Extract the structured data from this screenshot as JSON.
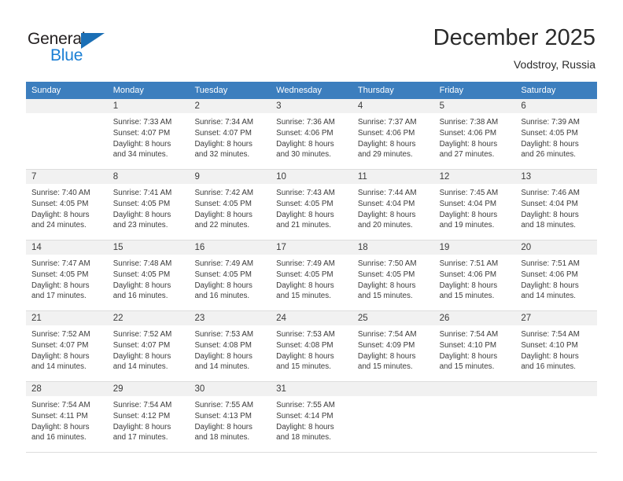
{
  "brand": {
    "name_top": "General",
    "name_bottom": "Blue",
    "triangle_color": "#1b6fb5",
    "blue_color": "#1b7fd4",
    "dark_color": "#231f20"
  },
  "header": {
    "title": "December 2025",
    "subtitle": "Vodstroy, Russia"
  },
  "theme": {
    "header_row_bg": "#3c7ebe",
    "header_row_text": "#ffffff",
    "daynum_band_bg": "#f1f1f1",
    "cell_text": "#3b3b3b",
    "row_divider": "#dddddd"
  },
  "weekdays": [
    "Sunday",
    "Monday",
    "Tuesday",
    "Wednesday",
    "Thursday",
    "Friday",
    "Saturday"
  ],
  "weeks": [
    [
      {
        "day": "",
        "lines": []
      },
      {
        "day": "1",
        "lines": [
          "Sunrise: 7:33 AM",
          "Sunset: 4:07 PM",
          "Daylight: 8 hours",
          "and 34 minutes."
        ]
      },
      {
        "day": "2",
        "lines": [
          "Sunrise: 7:34 AM",
          "Sunset: 4:07 PM",
          "Daylight: 8 hours",
          "and 32 minutes."
        ]
      },
      {
        "day": "3",
        "lines": [
          "Sunrise: 7:36 AM",
          "Sunset: 4:06 PM",
          "Daylight: 8 hours",
          "and 30 minutes."
        ]
      },
      {
        "day": "4",
        "lines": [
          "Sunrise: 7:37 AM",
          "Sunset: 4:06 PM",
          "Daylight: 8 hours",
          "and 29 minutes."
        ]
      },
      {
        "day": "5",
        "lines": [
          "Sunrise: 7:38 AM",
          "Sunset: 4:06 PM",
          "Daylight: 8 hours",
          "and 27 minutes."
        ]
      },
      {
        "day": "6",
        "lines": [
          "Sunrise: 7:39 AM",
          "Sunset: 4:05 PM",
          "Daylight: 8 hours",
          "and 26 minutes."
        ]
      }
    ],
    [
      {
        "day": "7",
        "lines": [
          "Sunrise: 7:40 AM",
          "Sunset: 4:05 PM",
          "Daylight: 8 hours",
          "and 24 minutes."
        ]
      },
      {
        "day": "8",
        "lines": [
          "Sunrise: 7:41 AM",
          "Sunset: 4:05 PM",
          "Daylight: 8 hours",
          "and 23 minutes."
        ]
      },
      {
        "day": "9",
        "lines": [
          "Sunrise: 7:42 AM",
          "Sunset: 4:05 PM",
          "Daylight: 8 hours",
          "and 22 minutes."
        ]
      },
      {
        "day": "10",
        "lines": [
          "Sunrise: 7:43 AM",
          "Sunset: 4:05 PM",
          "Daylight: 8 hours",
          "and 21 minutes."
        ]
      },
      {
        "day": "11",
        "lines": [
          "Sunrise: 7:44 AM",
          "Sunset: 4:04 PM",
          "Daylight: 8 hours",
          "and 20 minutes."
        ]
      },
      {
        "day": "12",
        "lines": [
          "Sunrise: 7:45 AM",
          "Sunset: 4:04 PM",
          "Daylight: 8 hours",
          "and 19 minutes."
        ]
      },
      {
        "day": "13",
        "lines": [
          "Sunrise: 7:46 AM",
          "Sunset: 4:04 PM",
          "Daylight: 8 hours",
          "and 18 minutes."
        ]
      }
    ],
    [
      {
        "day": "14",
        "lines": [
          "Sunrise: 7:47 AM",
          "Sunset: 4:05 PM",
          "Daylight: 8 hours",
          "and 17 minutes."
        ]
      },
      {
        "day": "15",
        "lines": [
          "Sunrise: 7:48 AM",
          "Sunset: 4:05 PM",
          "Daylight: 8 hours",
          "and 16 minutes."
        ]
      },
      {
        "day": "16",
        "lines": [
          "Sunrise: 7:49 AM",
          "Sunset: 4:05 PM",
          "Daylight: 8 hours",
          "and 16 minutes."
        ]
      },
      {
        "day": "17",
        "lines": [
          "Sunrise: 7:49 AM",
          "Sunset: 4:05 PM",
          "Daylight: 8 hours",
          "and 15 minutes."
        ]
      },
      {
        "day": "18",
        "lines": [
          "Sunrise: 7:50 AM",
          "Sunset: 4:05 PM",
          "Daylight: 8 hours",
          "and 15 minutes."
        ]
      },
      {
        "day": "19",
        "lines": [
          "Sunrise: 7:51 AM",
          "Sunset: 4:06 PM",
          "Daylight: 8 hours",
          "and 15 minutes."
        ]
      },
      {
        "day": "20",
        "lines": [
          "Sunrise: 7:51 AM",
          "Sunset: 4:06 PM",
          "Daylight: 8 hours",
          "and 14 minutes."
        ]
      }
    ],
    [
      {
        "day": "21",
        "lines": [
          "Sunrise: 7:52 AM",
          "Sunset: 4:07 PM",
          "Daylight: 8 hours",
          "and 14 minutes."
        ]
      },
      {
        "day": "22",
        "lines": [
          "Sunrise: 7:52 AM",
          "Sunset: 4:07 PM",
          "Daylight: 8 hours",
          "and 14 minutes."
        ]
      },
      {
        "day": "23",
        "lines": [
          "Sunrise: 7:53 AM",
          "Sunset: 4:08 PM",
          "Daylight: 8 hours",
          "and 14 minutes."
        ]
      },
      {
        "day": "24",
        "lines": [
          "Sunrise: 7:53 AM",
          "Sunset: 4:08 PM",
          "Daylight: 8 hours",
          "and 15 minutes."
        ]
      },
      {
        "day": "25",
        "lines": [
          "Sunrise: 7:54 AM",
          "Sunset: 4:09 PM",
          "Daylight: 8 hours",
          "and 15 minutes."
        ]
      },
      {
        "day": "26",
        "lines": [
          "Sunrise: 7:54 AM",
          "Sunset: 4:10 PM",
          "Daylight: 8 hours",
          "and 15 minutes."
        ]
      },
      {
        "day": "27",
        "lines": [
          "Sunrise: 7:54 AM",
          "Sunset: 4:10 PM",
          "Daylight: 8 hours",
          "and 16 minutes."
        ]
      }
    ],
    [
      {
        "day": "28",
        "lines": [
          "Sunrise: 7:54 AM",
          "Sunset: 4:11 PM",
          "Daylight: 8 hours",
          "and 16 minutes."
        ]
      },
      {
        "day": "29",
        "lines": [
          "Sunrise: 7:54 AM",
          "Sunset: 4:12 PM",
          "Daylight: 8 hours",
          "and 17 minutes."
        ]
      },
      {
        "day": "30",
        "lines": [
          "Sunrise: 7:55 AM",
          "Sunset: 4:13 PM",
          "Daylight: 8 hours",
          "and 18 minutes."
        ]
      },
      {
        "day": "31",
        "lines": [
          "Sunrise: 7:55 AM",
          "Sunset: 4:14 PM",
          "Daylight: 8 hours",
          "and 18 minutes."
        ]
      },
      {
        "day": "",
        "lines": []
      },
      {
        "day": "",
        "lines": []
      },
      {
        "day": "",
        "lines": []
      }
    ]
  ]
}
